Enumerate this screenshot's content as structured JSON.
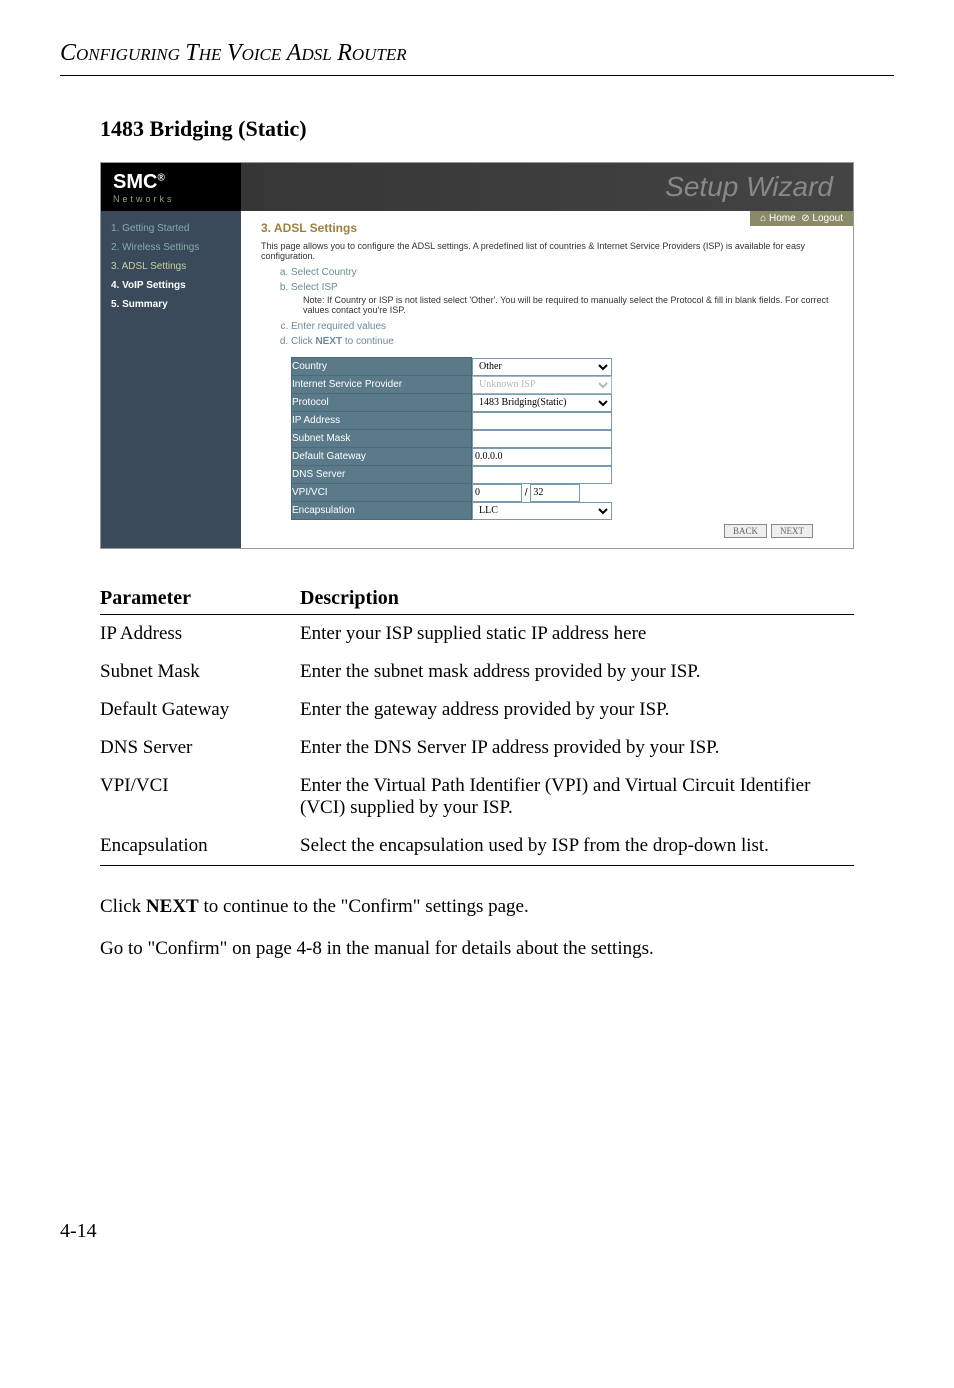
{
  "page_header": "CONFIGURING THE VOICE ADSL ROUTER",
  "section_title": "1483 Bridging (Static)",
  "screenshot": {
    "logo": "SMC",
    "logo_sub": "Networks",
    "wizard_title": "Setup Wizard",
    "homebar": {
      "home": "Home",
      "logout": "Logout"
    },
    "sidebar": [
      {
        "label": "1. Getting Started",
        "active": false
      },
      {
        "label": "2. Wireless Settings",
        "active": false
      },
      {
        "label": "3. ADSL Settings",
        "active": true
      },
      {
        "label": "4. VoIP Settings",
        "active": false
      },
      {
        "label": "5. Summary",
        "active": false
      }
    ],
    "main_title": "3. ADSL Settings",
    "info_text": "This page allows you to configure the ADSL settings. A predefined list of countries & Internet Service Providers (ISP) is available for easy configuration.",
    "steps": {
      "a": "Select Country",
      "b": "Select ISP",
      "b_note": "Note: If Country or ISP is not listed select 'Other'. You will be required to manually select the Protocol & fill in blank fields. For correct values contact you're ISP.",
      "c": "Enter required values",
      "d": "Click NEXT to continue"
    },
    "form": [
      {
        "label": "Country",
        "type": "select",
        "value": "Other"
      },
      {
        "label": "Internet Service Provider",
        "type": "select",
        "value": "Unknown ISP",
        "disabled": true
      },
      {
        "label": "Protocol",
        "type": "select",
        "value": "1483 Bridging(Static)"
      },
      {
        "label": "IP Address",
        "type": "text",
        "value": ""
      },
      {
        "label": "Subnet Mask",
        "type": "text",
        "value": ""
      },
      {
        "label": "Default Gateway",
        "type": "text",
        "value": "0.0.0.0"
      },
      {
        "label": "DNS Server",
        "type": "text",
        "value": ""
      },
      {
        "label": "VPI/VCI",
        "type": "vpivci",
        "vpi": "0",
        "vci": "32"
      },
      {
        "label": "Encapsulation",
        "type": "select",
        "value": "LLC"
      }
    ],
    "buttons": {
      "back": "BACK",
      "next": "NEXT"
    }
  },
  "param_table": {
    "col1": "Parameter",
    "col2": "Description",
    "rows": [
      {
        "p": "IP Address",
        "d": "Enter your ISP supplied static IP address here"
      },
      {
        "p": "Subnet Mask",
        "d": "Enter the subnet mask address provided by your ISP."
      },
      {
        "p": "Default Gateway",
        "d": "Enter the gateway address provided by your ISP."
      },
      {
        "p": "DNS Server",
        "d": "Enter the DNS Server IP address provided by your ISP."
      },
      {
        "p": "VPI/VCI",
        "d": "Enter the Virtual Path Identifier (VPI) and Virtual Circuit Identifier (VCI) supplied by your ISP."
      },
      {
        "p": "Encapsulation",
        "d": "Select the encapsulation used by ISP from the drop-down list."
      }
    ]
  },
  "body_text_1a": "Click ",
  "body_text_1b": "NEXT",
  "body_text_1c": " to continue to the \"Confirm\" settings page.",
  "body_text_2": "Go to \"Confirm\" on page 4-8 in the manual for details about the settings.",
  "page_number": "4-14"
}
